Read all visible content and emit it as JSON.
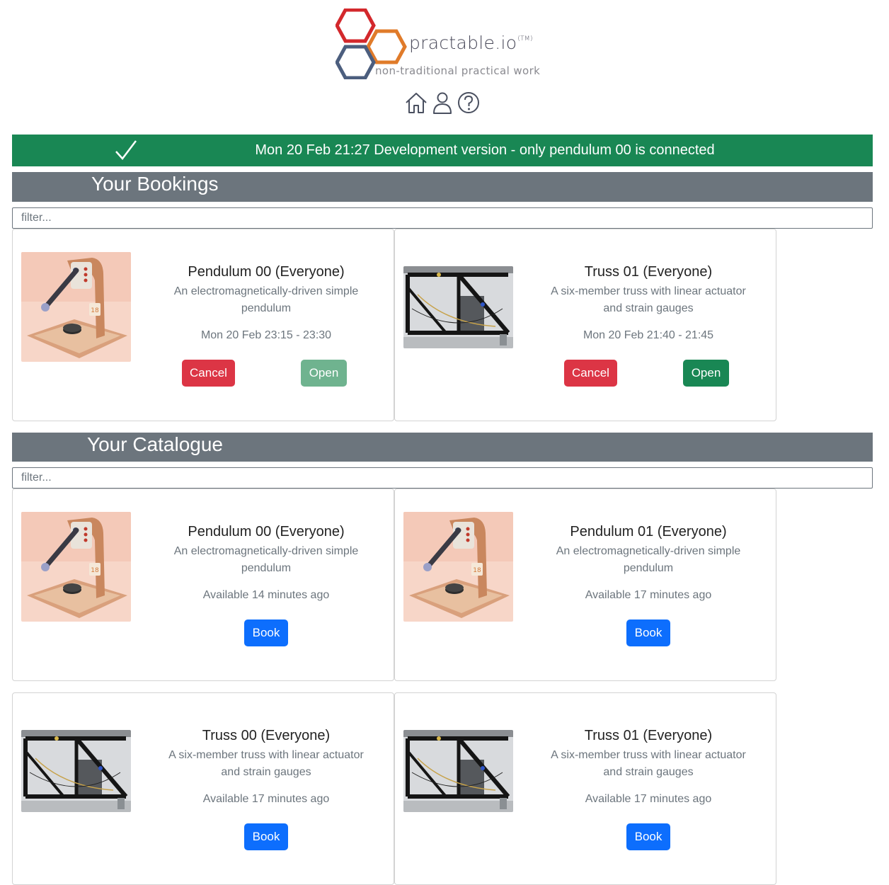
{
  "header": {
    "brand": "practable.io",
    "trademark": "(TM)",
    "tagline": "non-traditional practical work",
    "icons": [
      "home-icon",
      "user-icon",
      "help-icon"
    ]
  },
  "status": {
    "message": "Mon 20 Feb 21:27 Development version - only pendulum 00 is connected",
    "color": "#198754"
  },
  "bookings": {
    "heading": "Your Bookings",
    "filter_placeholder": "filter...",
    "items": [
      {
        "title": "Pendulum 00 (Everyone)",
        "description": "An electromagnetically-driven simple pendulum",
        "time": "Mon 20 Feb 23:15 - 23:30",
        "cancel_label": "Cancel",
        "open_label": "Open",
        "image": "pendulum"
      },
      {
        "title": "Truss 01 (Everyone)",
        "description": "A six-member truss with linear actuator and strain gauges",
        "time": "Mon 20 Feb 21:40 - 21:45",
        "cancel_label": "Cancel",
        "open_label": "Open",
        "image": "truss"
      }
    ]
  },
  "catalogue": {
    "heading": "Your Catalogue",
    "filter_placeholder": "filter...",
    "items": [
      {
        "title": "Pendulum 00 (Everyone)",
        "description": "An electromagnetically-driven simple pendulum",
        "availability": "Available 14 minutes ago",
        "book_label": "Book",
        "image": "pendulum"
      },
      {
        "title": "Pendulum 01 (Everyone)",
        "description": "An electromagnetically-driven simple pendulum",
        "availability": "Available 17 minutes ago",
        "book_label": "Book",
        "image": "pendulum"
      },
      {
        "title": "Truss 00 (Everyone)",
        "description": "A six-member truss with linear actuator and strain gauges",
        "availability": "Available 17 minutes ago",
        "book_label": "Book",
        "image": "truss"
      },
      {
        "title": "Truss 01 (Everyone)",
        "description": "A six-member truss with linear actuator and strain gauges",
        "availability": "Available 17 minutes ago",
        "book_label": "Book",
        "image": "truss"
      }
    ]
  }
}
